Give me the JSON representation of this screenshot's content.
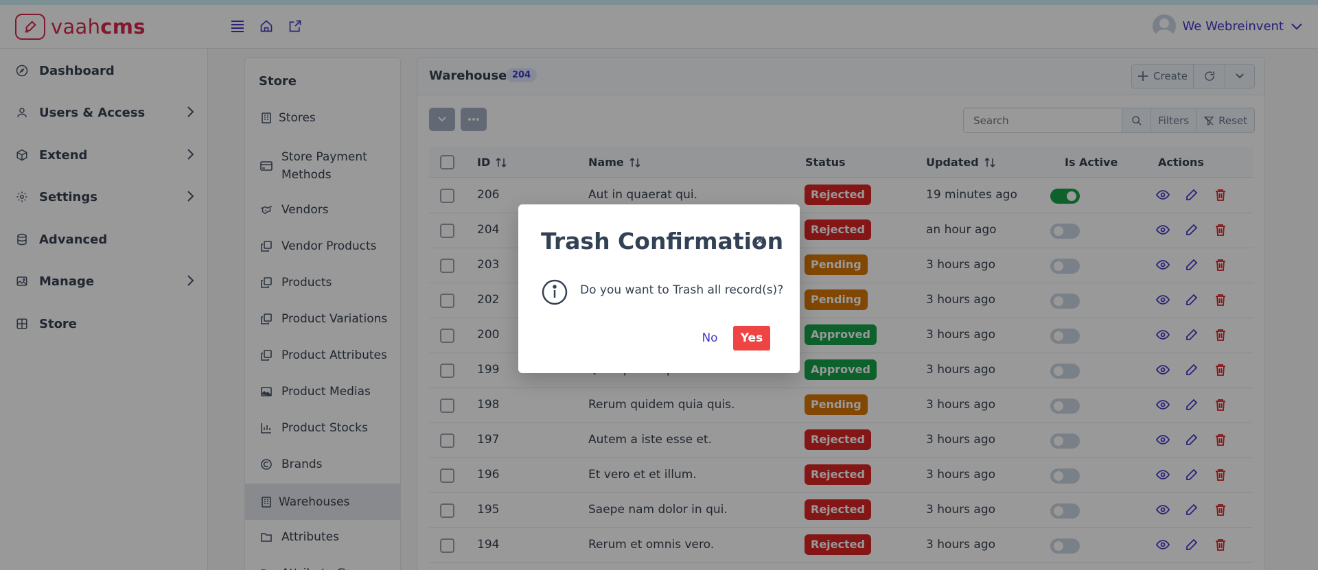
{
  "app": {
    "logo_text_light": "vaah",
    "logo_text_bold": "cms"
  },
  "header": {
    "icons": [
      "menu-icon",
      "home-icon",
      "external-link-icon"
    ],
    "user_name": "We Webreinvent"
  },
  "sidebar": {
    "items": [
      {
        "label": "Dashboard",
        "icon": "dashboard-icon",
        "chevron": false
      },
      {
        "label": "Users & Access",
        "icon": "user-icon",
        "chevron": true
      },
      {
        "label": "Extend",
        "icon": "box-icon",
        "chevron": true
      },
      {
        "label": "Settings",
        "icon": "gear-icon",
        "chevron": true
      },
      {
        "label": "Advanced",
        "icon": "database-icon",
        "chevron": false
      },
      {
        "label": "Manage",
        "icon": "images-icon",
        "chevron": true
      },
      {
        "label": "Store",
        "icon": "grid-icon",
        "chevron": false
      }
    ]
  },
  "store_menu": {
    "title": "Store",
    "items": [
      {
        "label": "Stores",
        "icon": "building-icon"
      },
      {
        "label": "Store Payment Methods",
        "icon": "credit-card-icon"
      },
      {
        "label": "Vendors",
        "icon": "handshake-icon"
      },
      {
        "label": "Vendor Products",
        "icon": "clone-icon"
      },
      {
        "label": "Products",
        "icon": "clone-icon"
      },
      {
        "label": "Product Variations",
        "icon": "clone-icon"
      },
      {
        "label": "Product Attributes",
        "icon": "clone-icon"
      },
      {
        "label": "Product Medias",
        "icon": "image-icon"
      },
      {
        "label": "Product Stocks",
        "icon": "chart-icon"
      },
      {
        "label": "Brands",
        "icon": "copyright-icon"
      },
      {
        "label": "Warehouses",
        "icon": "building-icon",
        "active": true
      },
      {
        "label": "Attributes",
        "icon": "folder-icon"
      },
      {
        "label": "Attribute Groups",
        "icon": "folder-icon"
      }
    ]
  },
  "main": {
    "title": "Warehouses",
    "count": "204",
    "create_label": "Create",
    "search_placeholder": "Search",
    "filters_label": "Filters",
    "reset_label": "Reset",
    "columns": [
      "ID",
      "Name",
      "Status",
      "Updated",
      "Is Active",
      "Actions"
    ],
    "rows": [
      {
        "id": "206",
        "name": "Aut in quaerat qui.",
        "status": "Rejected",
        "updated": "19 minutes ago",
        "active": true
      },
      {
        "id": "204",
        "name": "",
        "status": "Rejected",
        "updated": "an hour ago",
        "active": false
      },
      {
        "id": "203",
        "name": "",
        "status": "Pending",
        "updated": "3 hours ago",
        "active": false
      },
      {
        "id": "202",
        "name": "",
        "status": "Pending",
        "updated": "3 hours ago",
        "active": false
      },
      {
        "id": "200",
        "name": "",
        "status": "Approved",
        "updated": "3 hours ago",
        "active": false
      },
      {
        "id": "199",
        "name": "Quia quia id quo.",
        "status": "Approved",
        "updated": "3 hours ago",
        "active": false
      },
      {
        "id": "198",
        "name": "Rerum quidem quia quis.",
        "status": "Pending",
        "updated": "3 hours ago",
        "active": false
      },
      {
        "id": "197",
        "name": "Autem a iste esse et.",
        "status": "Rejected",
        "updated": "3 hours ago",
        "active": false
      },
      {
        "id": "196",
        "name": "Et vero et et illum.",
        "status": "Rejected",
        "updated": "3 hours ago",
        "active": false
      },
      {
        "id": "195",
        "name": "Saepe nam dolor in qui.",
        "status": "Rejected",
        "updated": "3 hours ago",
        "active": false
      },
      {
        "id": "194",
        "name": "Rerum et omnis vero.",
        "status": "Rejected",
        "updated": "3 hours ago",
        "active": false
      }
    ]
  },
  "status_colors": {
    "Rejected": "#dc2626",
    "Pending": "#d97706",
    "Approved": "#16a34a"
  },
  "modal": {
    "title": "Trash Confirmation",
    "message": "Do you want to Trash all record(s)?",
    "no_label": "No",
    "yes_label": "Yes"
  }
}
